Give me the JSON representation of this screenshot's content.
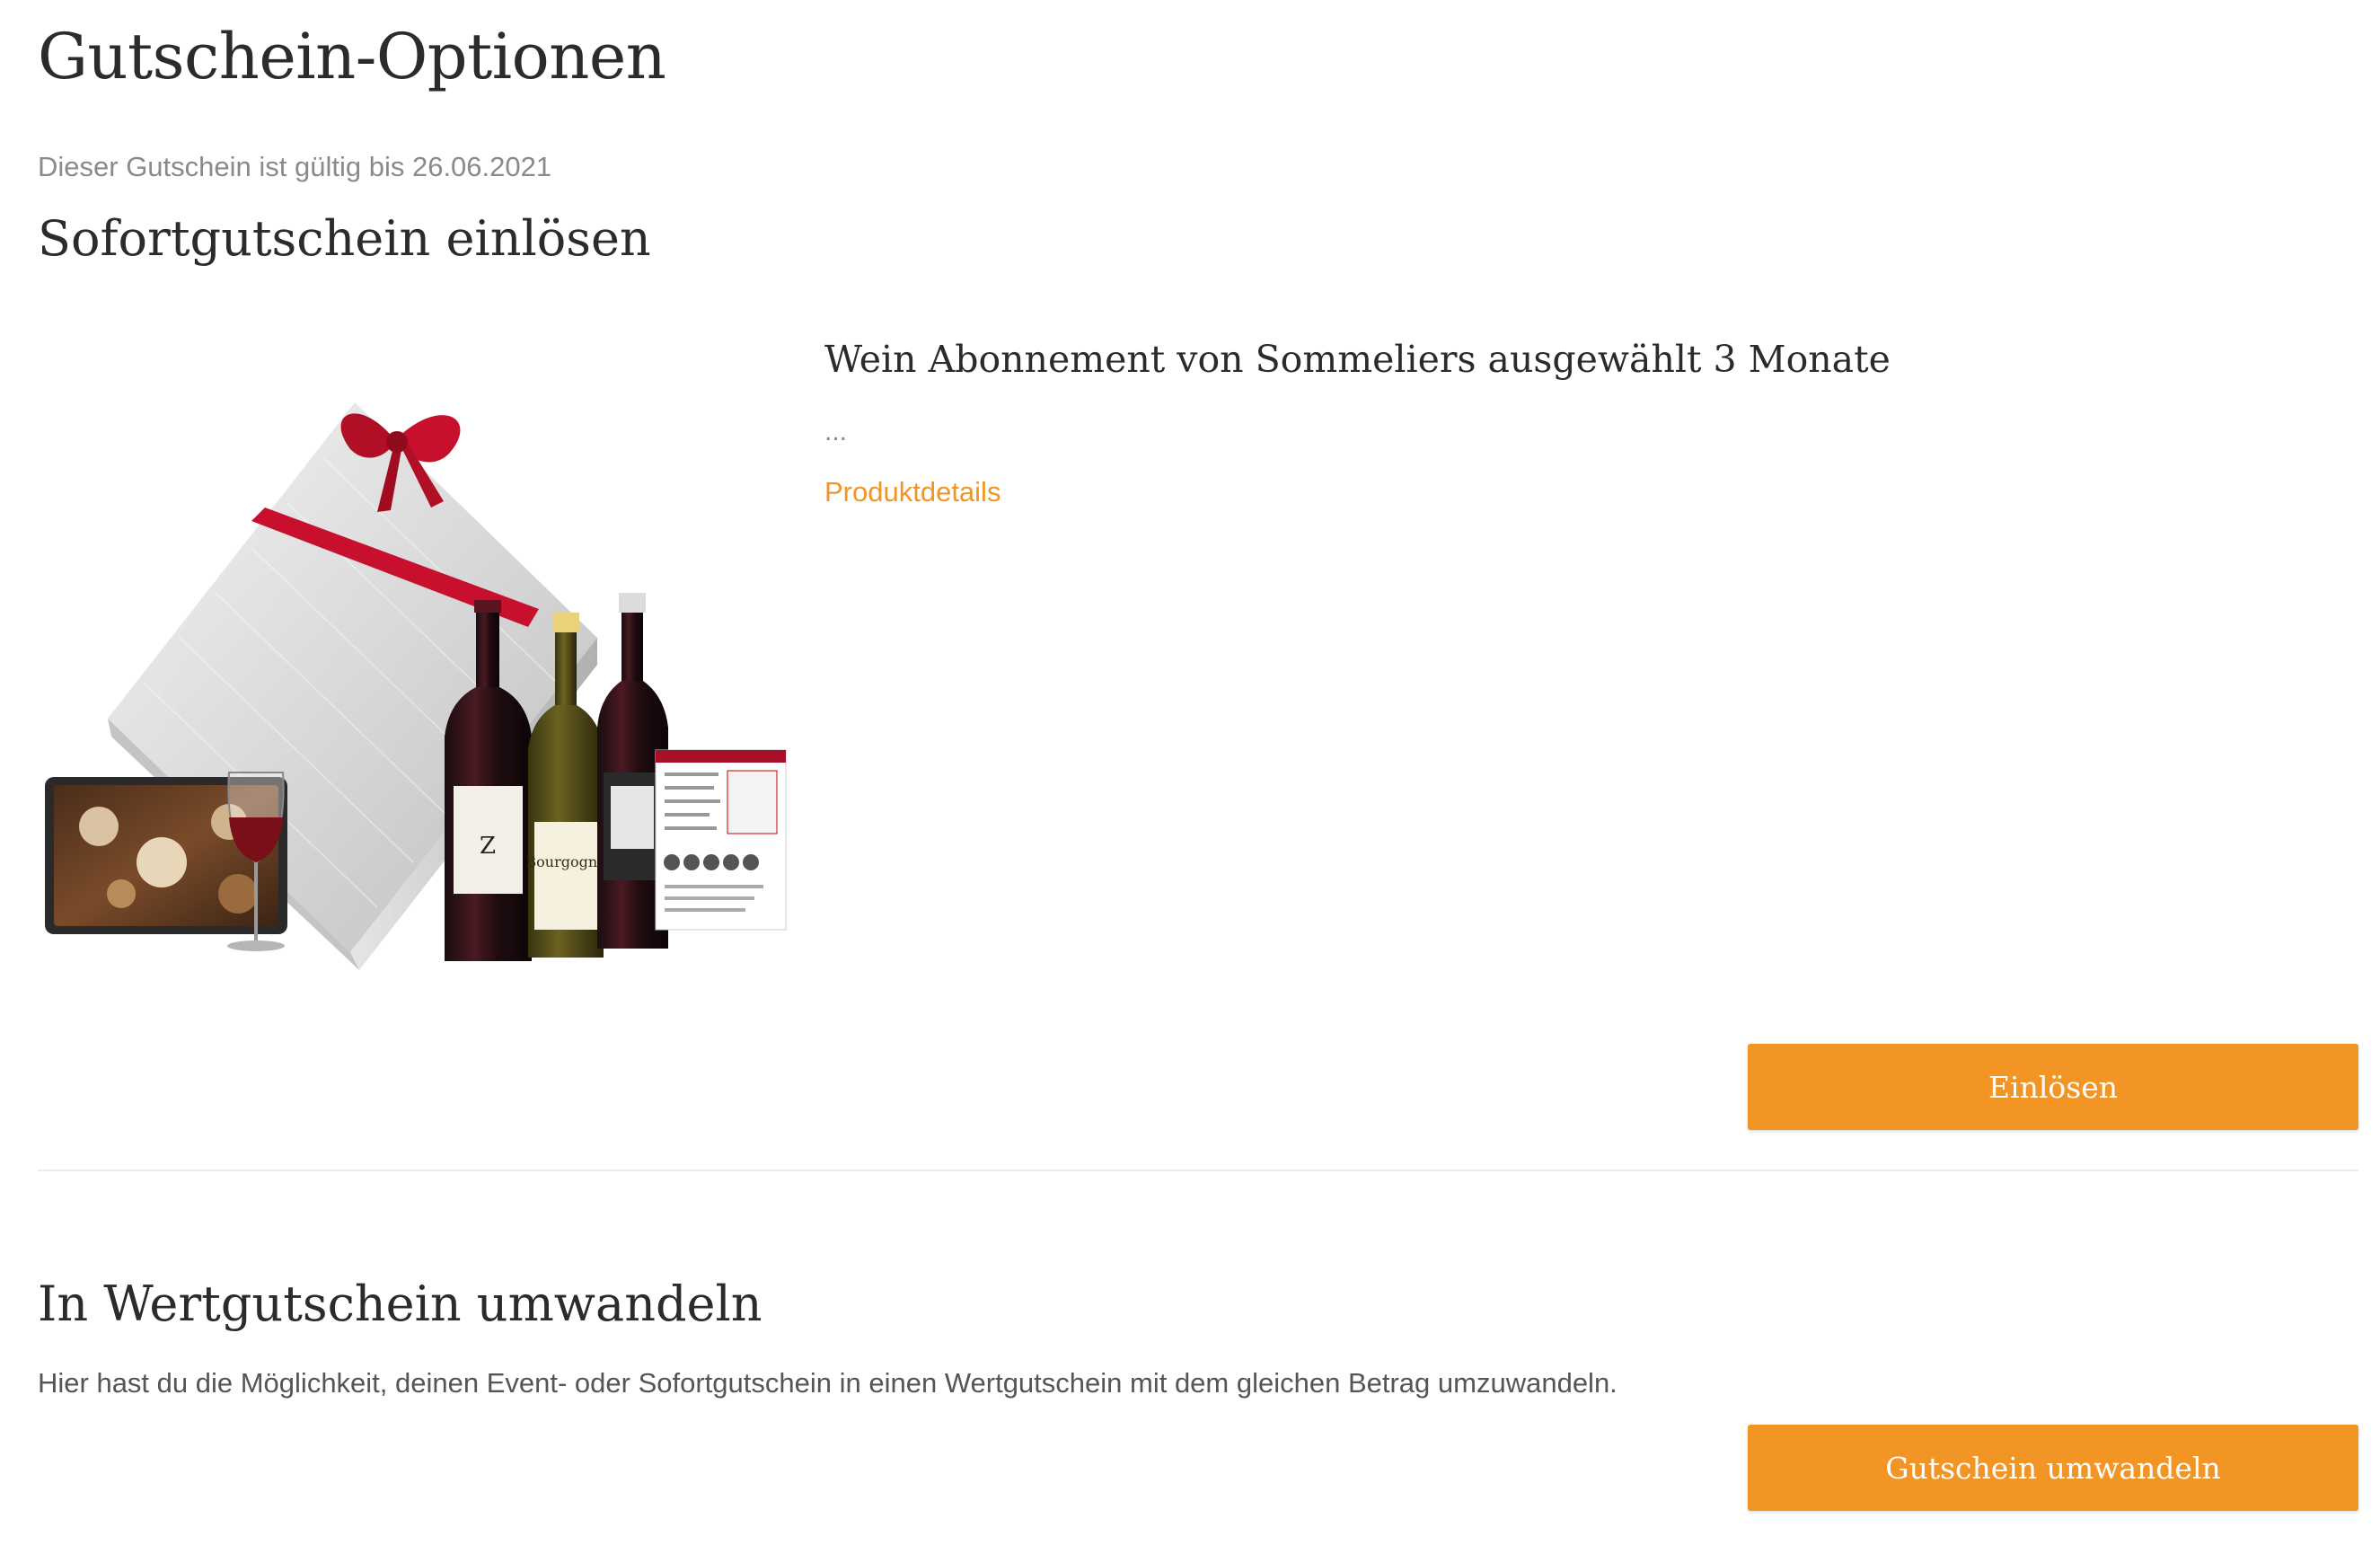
{
  "page": {
    "title": "Gutschein-Optionen",
    "validity_text": "Dieser Gutschein ist gültig bis 26.06.2021"
  },
  "redeem_section": {
    "title": "Sofortgutschein einlösen",
    "product": {
      "title": "Wein Abonnement von Sommeliers ausgewählt 3 Monate",
      "description": "...",
      "details_link": "Produktdetails"
    },
    "redeem_button": "Einlösen"
  },
  "convert_section": {
    "title": "In Wertgutschein umwandeln",
    "description": "Hier hast du die Möglichkeit, deinen Event- oder Sofortgutschein in einen Wertgutschein mit dem gleichen Betrag umzuwandeln.",
    "convert_button": "Gutschein umwandeln"
  },
  "colors": {
    "accent": "#f29524",
    "text_dark": "#2b2b2b",
    "text_muted": "#8a8a8a",
    "divider": "#ebebeb"
  }
}
